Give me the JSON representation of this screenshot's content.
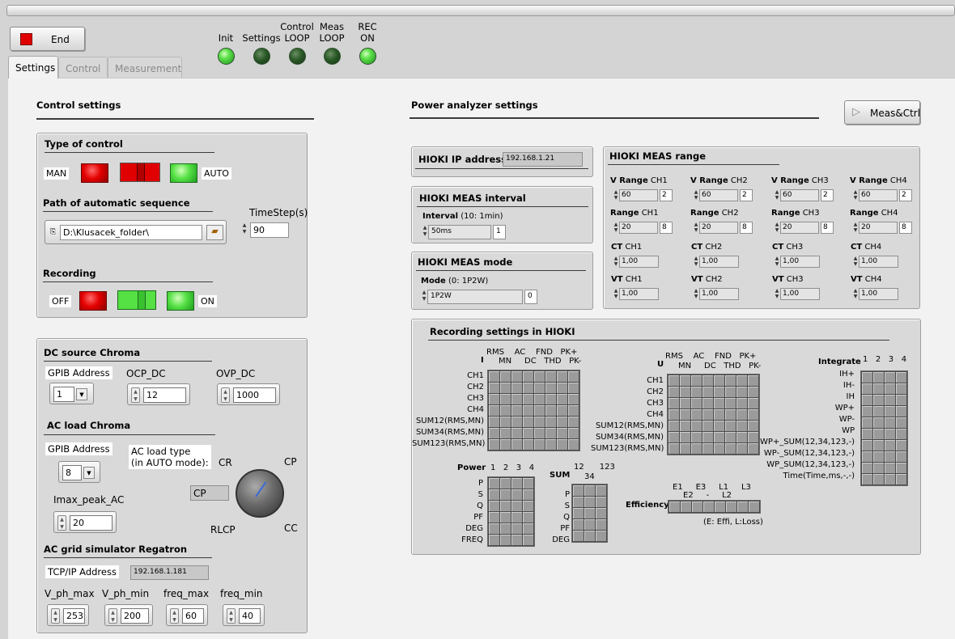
{
  "header": {
    "end_button": "End",
    "indicators": [
      {
        "label": "Init",
        "state": "on"
      },
      {
        "label": "Settings",
        "state": "off"
      },
      {
        "label": "Control\nLOOP",
        "state": "off"
      },
      {
        "label": "Meas\nLOOP",
        "state": "off"
      },
      {
        "label": "REC\nON",
        "state": "on"
      }
    ]
  },
  "tabs": [
    "Settings",
    "Control",
    "Measurement"
  ],
  "control_settings": {
    "title": "Control settings",
    "type_of_control": {
      "title": "Type of control",
      "man": "MAN",
      "auto": "AUTO"
    },
    "path": {
      "title": "Path of automatic sequence",
      "value": "D:\\Klusacek_folder\\"
    },
    "timestep": {
      "label": "TimeStep(s)",
      "value": "90"
    },
    "recording": {
      "title": "Recording",
      "off": "OFF",
      "on": "ON"
    }
  },
  "dc_source": {
    "title": "DC source Chroma",
    "gpib_label": "GPIB Address",
    "gpib_value": "1",
    "ocp_label": "OCP_DC",
    "ocp_value": "12",
    "ovp_label": "OVP_DC",
    "ovp_value": "1000"
  },
  "ac_load": {
    "title": "AC load Chroma",
    "gpib_label": "GPIB Address",
    "gpib_value": "8",
    "type_label": "AC load type\n(in AUTO mode):",
    "type_value": "CP",
    "knob": {
      "cr": "CR",
      "cp": "CP",
      "rlcp": "RLCP",
      "cc": "CC"
    },
    "imax_label": "Imax_peak_AC",
    "imax_value": "20"
  },
  "ac_grid": {
    "title": "AC grid simulator Regatron",
    "tcp_label": "TCP/IP Address",
    "tcp_value": "192.168.1.181",
    "params": [
      {
        "label": "V_ph_max",
        "value": "253"
      },
      {
        "label": "V_ph_min",
        "value": "200"
      },
      {
        "label": "freq_max",
        "value": "60"
      },
      {
        "label": "freq_min",
        "value": "40"
      }
    ]
  },
  "power_analyzer": {
    "title": "Power  analyzer settings",
    "meas_ctrl_button": "Meas&Ctrl",
    "ip": {
      "title": "HIOKI IP address",
      "value": "192.168.1.21"
    },
    "interval": {
      "title": "HIOKI MEAS interval",
      "label_b": "Interval",
      "label_n": "(10: 1min)",
      "value": "50ms",
      "num": "1"
    },
    "mode": {
      "title": "HIOKI MEAS mode",
      "label_b": "Mode",
      "label_n": "(0: 1P2W)",
      "value": "1P2W",
      "num": "0"
    },
    "range": {
      "title": "HIOKI MEAS range",
      "channels": [
        {
          "v_b": "V Range",
          "v_n": "CH1",
          "v": "60",
          "vi": "2",
          "r_b": "Range",
          "r_n": "CH1",
          "r": "20",
          "ri": "8",
          "ct_b": "CT",
          "ct_n": "CH1",
          "ct": "1,00",
          "vt_b": "VT",
          "vt_n": "CH1",
          "vt": "1,00"
        },
        {
          "v_b": "V Range",
          "v_n": "CH2",
          "v": "60",
          "vi": "2",
          "r_b": "Range",
          "r_n": "CH2",
          "r": "20",
          "ri": "8",
          "ct_b": "CT",
          "ct_n": "CH2",
          "ct": "1,00",
          "vt_b": "VT",
          "vt_n": "CH2",
          "vt": "1,00"
        },
        {
          "v_b": "V Range",
          "v_n": "CH3",
          "v": "60",
          "vi": "2",
          "r_b": "Range",
          "r_n": "CH3",
          "r": "20",
          "ri": "8",
          "ct_b": "CT",
          "ct_n": "CH3",
          "ct": "1,00",
          "vt_b": "VT",
          "vt_n": "CH3",
          "vt": "1,00"
        },
        {
          "v_b": "V Range",
          "v_n": "CH4",
          "v": "60",
          "vi": "2",
          "r_b": "Range",
          "r_n": "CH4",
          "r": "20",
          "ri": "8",
          "ct_b": "CT",
          "ct_n": "CH4",
          "ct": "1,00",
          "vt_b": "VT",
          "vt_n": "CH4",
          "vt": "1,00"
        }
      ]
    },
    "recording": {
      "title": "Recording settings in HIOKI",
      "i_matrix": {
        "label": "I",
        "cols_top": "RMS    AC    FND   PK+",
        "cols_bot": "MN     DC   THD   PK-",
        "rows": [
          "CH1",
          "CH2",
          "CH3",
          "CH4",
          "SUM12(RMS,MN)",
          "SUM34(RMS,MN)",
          "SUM123(RMS,MN)"
        ]
      },
      "u_matrix": {
        "label": "U",
        "cols_top": "RMS    AC    FND   PK+",
        "cols_bot": "MN     DC   THD   PK-",
        "rows": [
          "CH1",
          "CH2",
          "CH3",
          "CH4",
          "SUM12(RMS,MN)",
          "SUM34(RMS,MN)",
          "SUM123(RMS,MN)"
        ]
      },
      "integrate": {
        "label": "Integrate",
        "cols": "1   2   3   4",
        "rows": [
          "IH+",
          "IH-",
          "IH",
          "WP+",
          "WP-",
          "WP",
          "WP+_SUM(12,34,123,-)",
          "WP-_SUM(12,34,123,-)",
          "WP_SUM(12,34,123,-)",
          "Time(Time,ms,-,-)"
        ]
      },
      "power": {
        "label": "Power",
        "cols": "1   2   3   4",
        "rows": [
          "P",
          "S",
          "Q",
          "PF",
          "DEG",
          "FREQ"
        ]
      },
      "sum": {
        "label": "SUM",
        "cols_top": "12      123",
        "cols_bot": "34",
        "rows": [
          "P",
          "S",
          "Q",
          "PF",
          "DEG"
        ]
      },
      "efficiency": {
        "label": "Efficiency",
        "cols_top": "E1     E3     L1     L3",
        "cols_bot": "E2     -     L2",
        "note": "(E: Effi, L:Loss)"
      }
    }
  }
}
